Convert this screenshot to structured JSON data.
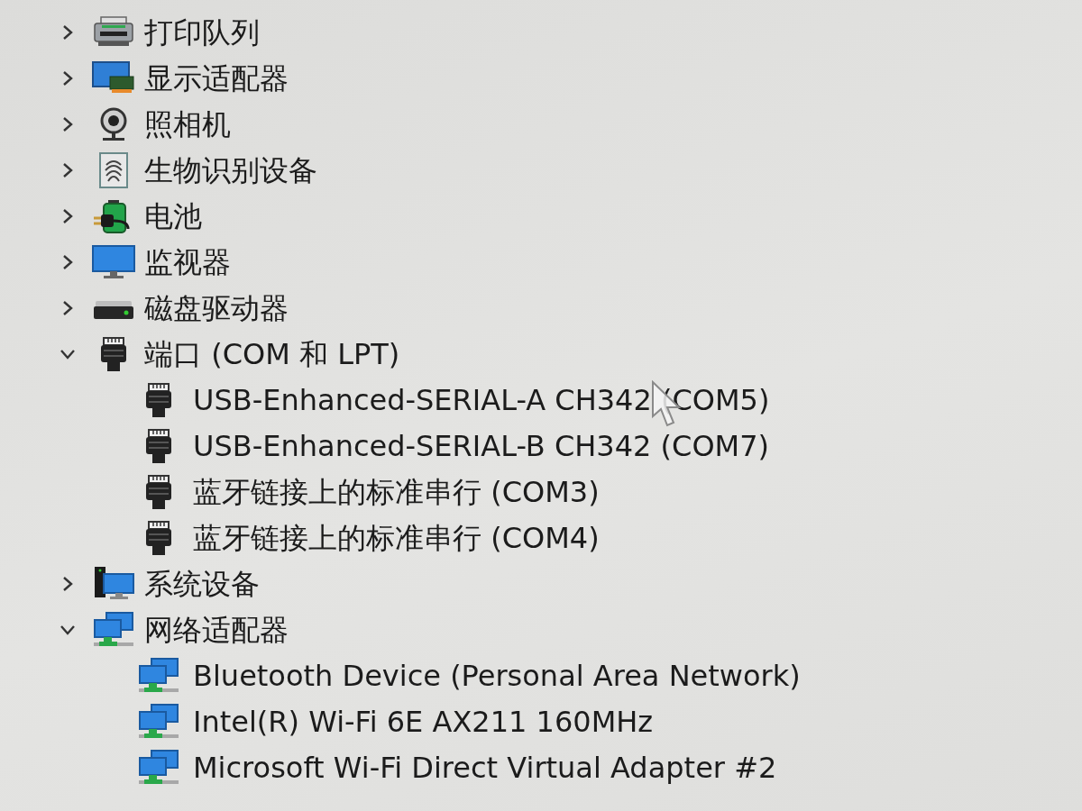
{
  "tree": [
    {
      "label": "打印队列",
      "kind": "printer",
      "expanded": false
    },
    {
      "label": "显示适配器",
      "kind": "display-adapter",
      "expanded": false
    },
    {
      "label": "照相机",
      "kind": "camera",
      "expanded": false
    },
    {
      "label": "生物识别设备",
      "kind": "biometric",
      "expanded": false
    },
    {
      "label": "电池",
      "kind": "battery",
      "expanded": false
    },
    {
      "label": "监视器",
      "kind": "monitor",
      "expanded": false
    },
    {
      "label": "磁盘驱动器",
      "kind": "disk",
      "expanded": false
    },
    {
      "label": "端口 (COM 和 LPT)",
      "kind": "port",
      "expanded": true,
      "children": [
        {
          "label": "USB-Enhanced-SERIAL-A CH342 (COM5)",
          "kind": "port"
        },
        {
          "label": "USB-Enhanced-SERIAL-B CH342 (COM7)",
          "kind": "port"
        },
        {
          "label": "蓝牙链接上的标准串行 (COM3)",
          "kind": "port"
        },
        {
          "label": "蓝牙链接上的标准串行 (COM4)",
          "kind": "port"
        }
      ]
    },
    {
      "label": "系统设备",
      "kind": "system",
      "expanded": false
    },
    {
      "label": "网络适配器",
      "kind": "network",
      "expanded": true,
      "children": [
        {
          "label": "Bluetooth Device (Personal Area Network)",
          "kind": "network"
        },
        {
          "label": "Intel(R) Wi-Fi 6E AX211 160MHz",
          "kind": "network"
        },
        {
          "label": "Microsoft Wi-Fi Direct Virtual Adapter #2",
          "kind": "network"
        }
      ]
    }
  ]
}
